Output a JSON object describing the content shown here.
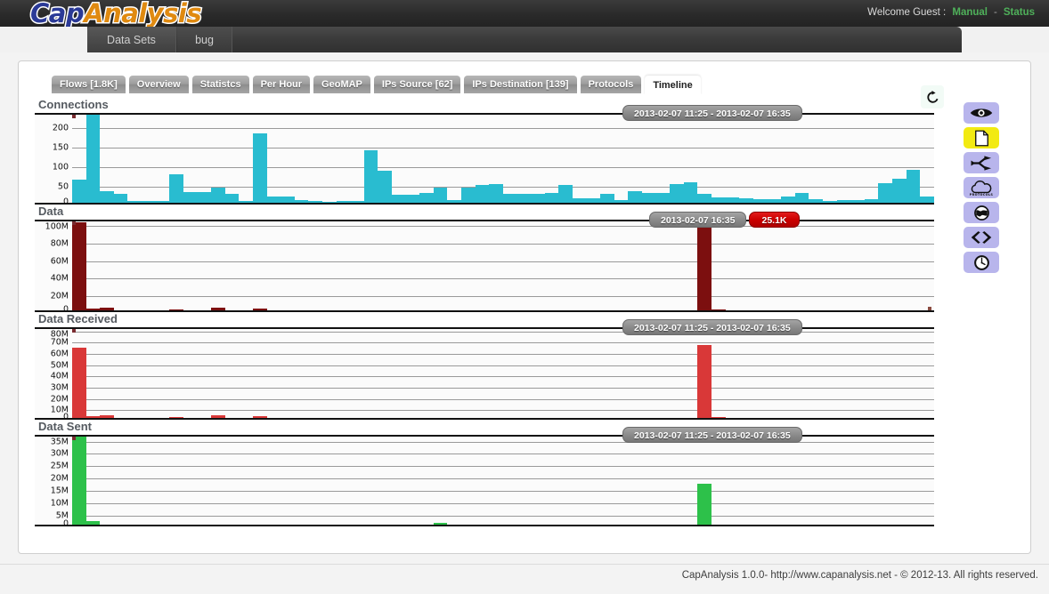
{
  "header": {
    "logo_cap": "Cap",
    "logo_analysis": "Analysis",
    "welcome_text": "Welcome Guest :",
    "manual_label": "Manual",
    "separator": "-",
    "status_label": "Status"
  },
  "menu": {
    "items": [
      {
        "label": "Data Sets"
      },
      {
        "label": "bug"
      }
    ]
  },
  "tabs": [
    {
      "label": "Flows [1.8K]",
      "active": false
    },
    {
      "label": "Overview",
      "active": false
    },
    {
      "label": "Statistcs",
      "active": false
    },
    {
      "label": "Per Hour",
      "active": false
    },
    {
      "label": "GeoMAP",
      "active": false
    },
    {
      "label": "IPs Source [62]",
      "active": false
    },
    {
      "label": "IPs Destination [139]",
      "active": false
    },
    {
      "label": "Protocols",
      "active": false
    },
    {
      "label": "Timeline",
      "active": true
    }
  ],
  "toolbar": {
    "refresh_label": "refresh"
  },
  "rail": {
    "items": [
      {
        "name": "eye-icon",
        "label": "Overview",
        "highlight": false
      },
      {
        "name": "page-icon",
        "label": "Report",
        "highlight": true
      },
      {
        "name": "share-icon",
        "label": "Flows",
        "highlight": false
      },
      {
        "name": "cloud-protocols-icon",
        "label": "PROTOCOLS",
        "highlight": false
      },
      {
        "name": "globe-icon",
        "label": "GeoMAP",
        "highlight": false
      },
      {
        "name": "code-icon",
        "label": "Source",
        "highlight": false
      },
      {
        "name": "clock-icon",
        "label": "Timeline",
        "highlight": false
      }
    ]
  },
  "footer": {
    "text": "CapAnalysis 1.0.0- http://www.capanalysis.net - © 2012-13. All rights reserved."
  },
  "chart_data": [
    {
      "id": "connections",
      "type": "bar",
      "title": "Connections",
      "xlabel": "",
      "ylabel": "",
      "ylim": [
        0,
        235
      ],
      "yticks": [
        0,
        50,
        100,
        150,
        200
      ],
      "ytick_labels": [
        "0",
        "50",
        "100",
        "150",
        "200"
      ],
      "grid": true,
      "color": "#29bcd0",
      "tooltip": {
        "range_label": "2013-02-07 11:25 - 2013-02-07 16:35"
      },
      "range_label": "2013-02-07 11:25 - 2013-02-07 16:35",
      "values": [
        60,
        228,
        29,
        22,
        5,
        5,
        4,
        74,
        28,
        27,
        39,
        22,
        5,
        178,
        16,
        16,
        7,
        4,
        3,
        5,
        4,
        134,
        82,
        20,
        20,
        24,
        38,
        8,
        38,
        45,
        48,
        22,
        22,
        22,
        26,
        46,
        12,
        12,
        22,
        6,
        30,
        26,
        24,
        48,
        52,
        22,
        14,
        14,
        12,
        10,
        10,
        16,
        26,
        10,
        5,
        6,
        6,
        10,
        50,
        62,
        85,
        16
      ]
    },
    {
      "id": "data",
      "type": "bar",
      "title": "Data",
      "xlabel": "",
      "ylabel": "",
      "ylim": [
        0,
        105000000
      ],
      "yticks": [
        0,
        20000000,
        40000000,
        60000000,
        80000000,
        100000000
      ],
      "ytick_labels": [
        "0",
        "20M",
        "40M",
        "60M",
        "80M",
        "100M"
      ],
      "grid": true,
      "color": "#7c0f0f",
      "tooltip": {
        "time_label": "2013-02-07 16:35",
        "value_label": "25.1K"
      },
      "range_label": "2013-02-07 16:35",
      "values": [
        100000000,
        2000000,
        3500000,
        0,
        0,
        0,
        0,
        1200000,
        0,
        0,
        2800000,
        0,
        0,
        2000000,
        0,
        0,
        0,
        0,
        0,
        0,
        0,
        0,
        0,
        0,
        0,
        0,
        0,
        0,
        0,
        0,
        0,
        0,
        0,
        0,
        0,
        0,
        0,
        0,
        0,
        0,
        0,
        0,
        0,
        0,
        0,
        95000000,
        700000,
        0,
        0,
        0,
        0,
        0,
        0,
        0,
        0,
        0,
        0,
        0,
        0,
        0,
        0,
        0
      ]
    },
    {
      "id": "data-received",
      "type": "bar",
      "title": "Data Received",
      "xlabel": "",
      "ylabel": "",
      "ylim": [
        0,
        82000000
      ],
      "yticks": [
        0,
        10000000,
        20000000,
        30000000,
        40000000,
        50000000,
        60000000,
        70000000,
        80000000
      ],
      "ytick_labels": [
        "0",
        "10M",
        "20M",
        "30M",
        "40M",
        "50M",
        "60M",
        "70M",
        "80M"
      ],
      "grid": true,
      "color": "#d93838",
      "tooltip": {
        "range_label": "2013-02-07 11:25 - 2013-02-07 16:35"
      },
      "range_label": "2013-02-07 11:25 - 2013-02-07 16:35",
      "values": [
        62000000,
        1500000,
        2200000,
        0,
        0,
        0,
        0,
        900000,
        0,
        0,
        2200000,
        0,
        0,
        1500000,
        0,
        0,
        0,
        0,
        0,
        0,
        0,
        0,
        0,
        0,
        0,
        0,
        0,
        0,
        0,
        0,
        0,
        0,
        0,
        0,
        0,
        0,
        0,
        0,
        0,
        0,
        0,
        0,
        0,
        0,
        0,
        65000000,
        500000,
        0,
        0,
        0,
        0,
        0,
        0,
        0,
        0,
        0,
        0,
        0,
        0,
        0,
        0,
        0
      ]
    },
    {
      "id": "data-sent",
      "type": "bar",
      "title": "Data Sent",
      "xlabel": "",
      "ylabel": "",
      "ylim": [
        0,
        37000000
      ],
      "yticks": [
        0,
        5000000,
        10000000,
        15000000,
        20000000,
        25000000,
        30000000,
        35000000
      ],
      "ytick_labels": [
        "0",
        "5M",
        "10M",
        "15M",
        "20M",
        "25M",
        "30M",
        "35M"
      ],
      "grid": true,
      "color": "#2dc14a",
      "tooltip": {
        "range_label": "2013-02-07 11:25 - 2013-02-07 16:35"
      },
      "range_label": "2013-02-07 11:25 - 2013-02-07 16:35",
      "values": [
        37000000,
        1400000,
        0,
        0,
        0,
        0,
        0,
        0,
        0,
        0,
        0,
        0,
        0,
        0,
        0,
        0,
        0,
        0,
        0,
        0,
        0,
        0,
        0,
        0,
        0,
        0,
        600000,
        0,
        0,
        0,
        0,
        0,
        0,
        0,
        0,
        0,
        0,
        0,
        0,
        0,
        0,
        0,
        0,
        0,
        0,
        16500000,
        0,
        0,
        0,
        0,
        0,
        0,
        0,
        0,
        0,
        0,
        0,
        0,
        0,
        0,
        0,
        0
      ]
    }
  ]
}
